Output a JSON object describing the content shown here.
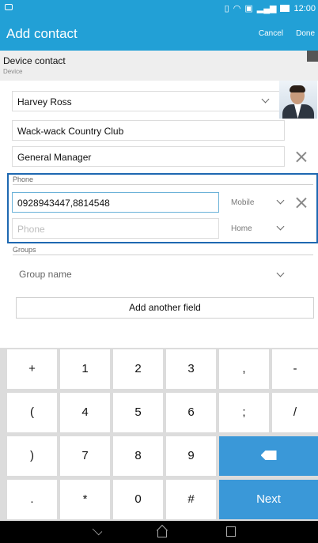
{
  "status": {
    "time": "12:00"
  },
  "header": {
    "title": "Add contact",
    "cancel": "Cancel",
    "done": "Done"
  },
  "account": {
    "name": "Device contact",
    "type": "Device"
  },
  "fields": {
    "name": "Harvey Ross",
    "company": "Wack-wack Country Club",
    "title": "General Manager"
  },
  "phone": {
    "label": "Phone",
    "entries": [
      {
        "value": "0928943447,8814548",
        "type": "Mobile"
      },
      {
        "placeholder": "Phone",
        "type": "Home"
      }
    ]
  },
  "groups": {
    "label": "Groups",
    "placeholder": "Group name"
  },
  "add_field": "Add another field",
  "keyboard": {
    "rows": [
      [
        "+",
        "1",
        "2",
        "3",
        ",",
        "-"
      ],
      [
        "(",
        "4",
        "5",
        "6",
        ";",
        "/"
      ],
      [
        ")",
        "7",
        "8",
        "9"
      ],
      [
        ".",
        "*",
        "0",
        "#",
        "Next"
      ]
    ]
  },
  "colors": {
    "accent": "#22a0d6",
    "focus": "#1e68b1",
    "action_key": "#3a98d8"
  }
}
